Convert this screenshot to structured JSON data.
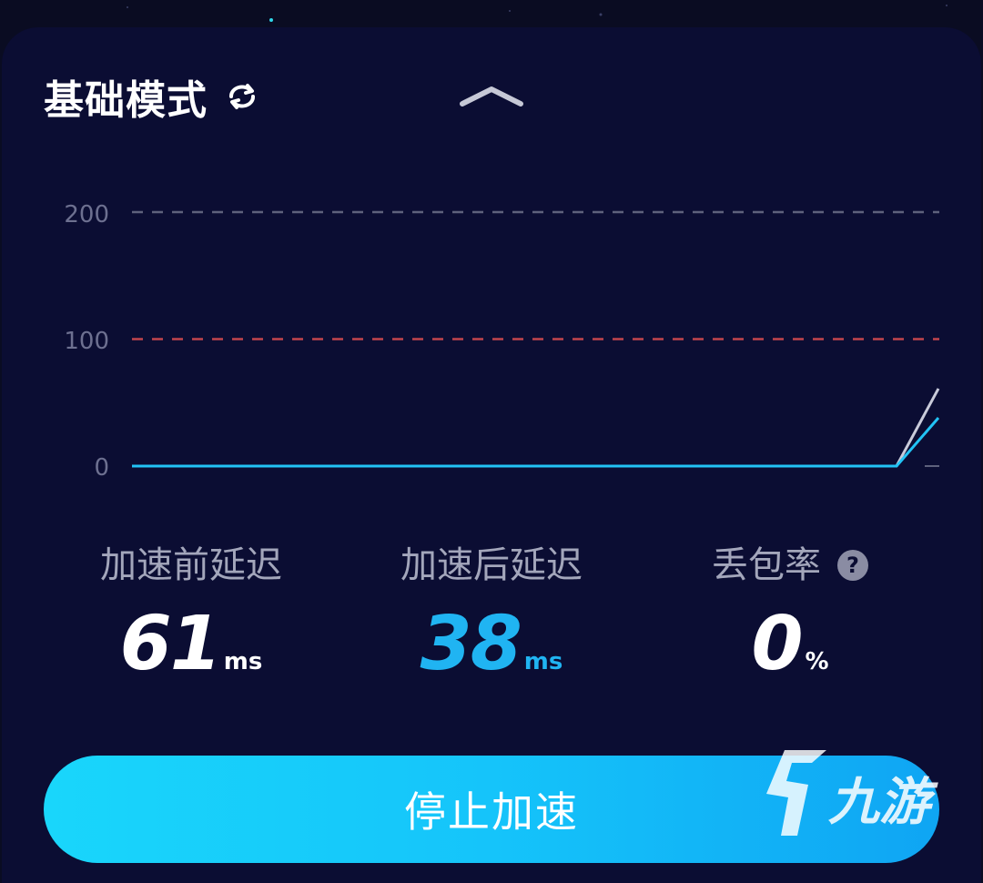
{
  "header": {
    "mode_label": "基础模式",
    "switch_icon": "refresh-icon",
    "collapse_icon": "chevron-up-icon"
  },
  "chart_data": {
    "type": "line",
    "y_ticks": [
      "200",
      "100",
      "0"
    ],
    "ylim": [
      0,
      200
    ],
    "reference_lines": [
      {
        "value": 200,
        "color": "#5e617c",
        "style": "dashed"
      },
      {
        "value": 100,
        "color": "#c2454d",
        "style": "dashed"
      }
    ],
    "series": [
      {
        "values": [
          0,
          0,
          0,
          0,
          0,
          0,
          0,
          0,
          0,
          0,
          0,
          0,
          0,
          0,
          0,
          0,
          0,
          0,
          0,
          0,
          0,
          0,
          0,
          0,
          0,
          0,
          0,
          0,
          0,
          0,
          0,
          0,
          0,
          0,
          0,
          0,
          0,
          0,
          0,
          0,
          0,
          0,
          0,
          0,
          0,
          0,
          0,
          0,
          0,
          0,
          0,
          0,
          0,
          0,
          0,
          0,
          0,
          0,
          0,
          0,
          0,
          61
        ],
        "color": "#c9cbda"
      },
      {
        "values": [
          0,
          0,
          0,
          0,
          0,
          0,
          0,
          0,
          0,
          0,
          0,
          0,
          0,
          0,
          0,
          0,
          0,
          0,
          0,
          0,
          0,
          0,
          0,
          0,
          0,
          0,
          0,
          0,
          0,
          0,
          0,
          0,
          0,
          0,
          0,
          0,
          0,
          0,
          0,
          0,
          0,
          0,
          0,
          0,
          0,
          0,
          0,
          0,
          0,
          0,
          0,
          0,
          0,
          0,
          0,
          0,
          0,
          0,
          0,
          0,
          0,
          38
        ],
        "color": "#22c3f5"
      }
    ]
  },
  "metrics": {
    "before": {
      "label": "加速前延迟",
      "value": "61",
      "unit": "ms"
    },
    "after": {
      "label": "加速后延迟",
      "value": "38",
      "unit": "ms"
    },
    "loss": {
      "label": "丢包率",
      "value": "0",
      "unit": "%",
      "help": "?"
    }
  },
  "actions": {
    "stop_label": "停止加速"
  },
  "colors": {
    "panel": "#0b0d33",
    "accent": "#20b4f2",
    "button": "#15c4fa"
  },
  "watermark": {
    "text": "九游"
  }
}
